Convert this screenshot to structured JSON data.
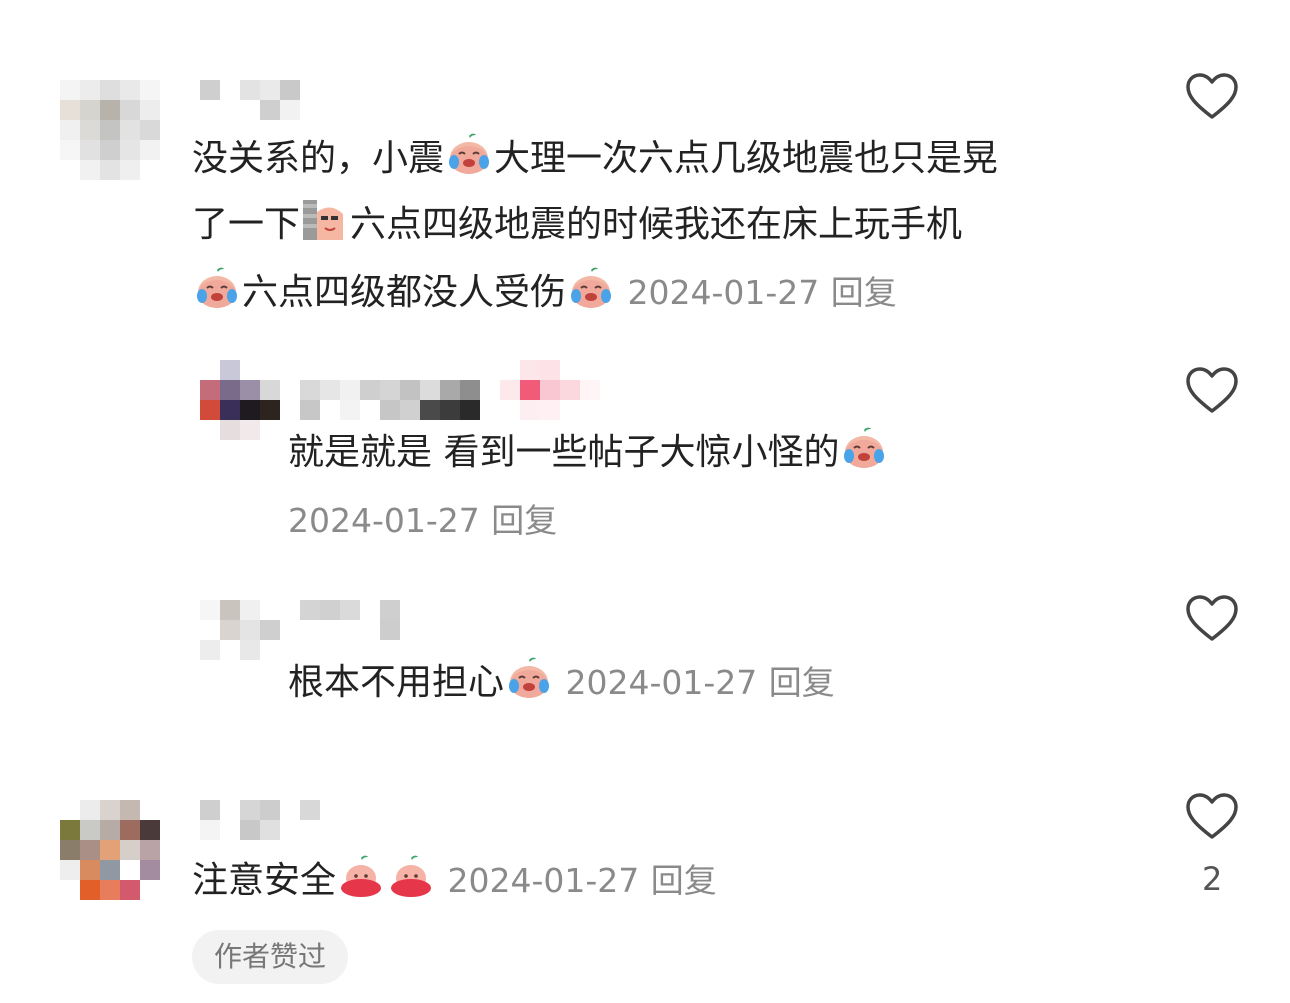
{
  "comments": [
    {
      "lines": [
        [
          "没关系的，小震",
          "cry-laugh-emoji",
          "大理一次六点几级地震也只是晃"
        ],
        [
          "了一下",
          "peek-wall-emoji",
          "六点四级地震的时候我还在床上玩手机"
        ],
        [
          "",
          "cry-laugh-emoji",
          "六点四级都没人受伤",
          "cry-laugh-emoji"
        ]
      ],
      "date": "2024-01-27",
      "reply_label": "回复",
      "like_icon": "heart-outline-icon"
    },
    {
      "text": "就是就是 看到一些帖子大惊小怪的",
      "emoji": "cry-laugh-emoji",
      "date": "2024-01-27",
      "reply_label": "回复",
      "like_icon": "heart-outline-icon"
    },
    {
      "text": "根本不用担心",
      "emoji": "cry-laugh-emoji",
      "date": "2024-01-27",
      "reply_label": "回复",
      "like_icon": "heart-outline-icon"
    },
    {
      "text": "注意安全",
      "emoji": "red-peach-emoji",
      "date": "2024-01-27",
      "reply_label": "回复",
      "like_icon": "heart-outline-icon",
      "like_count": "2",
      "badge": "作者赞过"
    }
  ]
}
